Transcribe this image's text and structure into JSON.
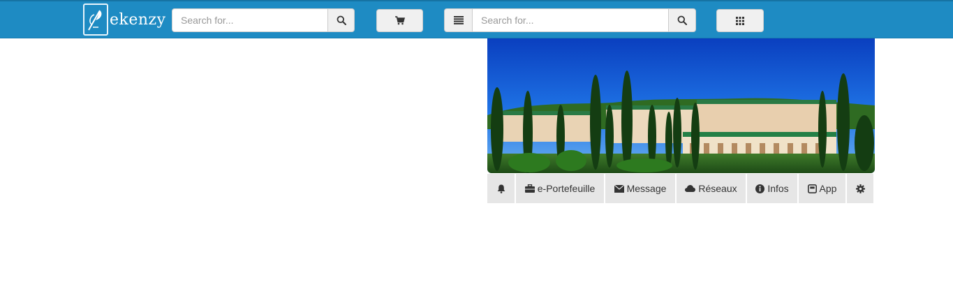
{
  "brand": {
    "name": "ekenzy",
    "logo_icon": "quill-logo-icon"
  },
  "colors": {
    "topbar": "#1e8bc3",
    "tab_bg": "#e6e6e6",
    "text": "#333333"
  },
  "search_primary": {
    "placeholder": "Search for...",
    "button_icon": "search-icon"
  },
  "cart": {
    "icon": "cart-icon"
  },
  "search_secondary": {
    "placeholder": "Search for...",
    "menu_icon": "list-icon",
    "button_icon": "search-icon"
  },
  "apps": {
    "icon": "grid-icon"
  },
  "banner": {
    "image": "campus-panorama"
  },
  "tabs": [
    {
      "icon": "bell-icon",
      "label": ""
    },
    {
      "icon": "briefcase-icon",
      "label": "e-Portefeuille"
    },
    {
      "icon": "envelope-icon",
      "label": "Message"
    },
    {
      "icon": "cloud-icon",
      "label": "Réseaux"
    },
    {
      "icon": "info-icon",
      "label": "Infos"
    },
    {
      "icon": "app-icon",
      "label": "App"
    },
    {
      "icon": "gear-icon",
      "label": ""
    }
  ]
}
